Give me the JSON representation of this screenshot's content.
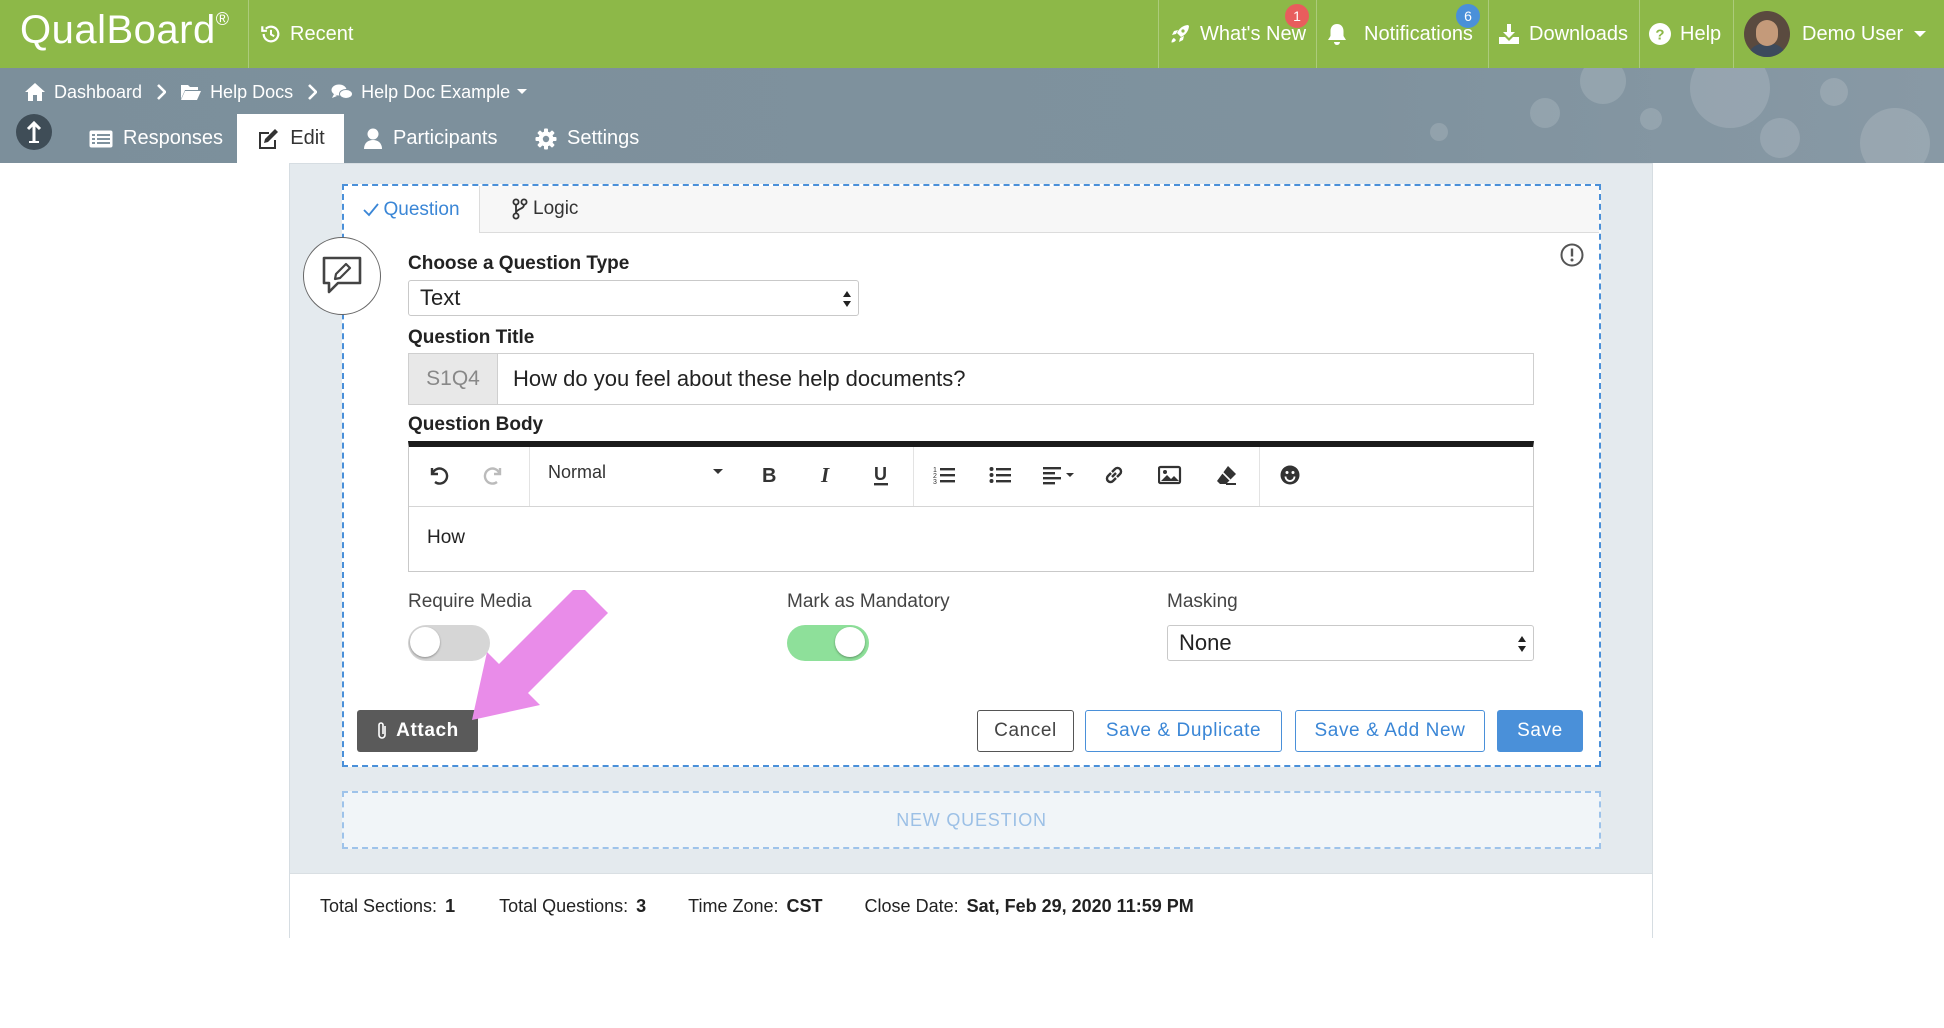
{
  "app": {
    "logo": "QualBoard",
    "logo_mark": "®"
  },
  "topnav": {
    "recent": "Recent",
    "whats_new": "What's New",
    "whats_new_badge": "1",
    "notifications": "Notifications",
    "notifications_badge": "6",
    "downloads": "Downloads",
    "help": "Help",
    "user": "Demo User"
  },
  "breadcrumb": {
    "dashboard": "Dashboard",
    "help_docs": "Help Docs",
    "current": "Help Doc Example"
  },
  "tabs": {
    "responses": "Responses",
    "edit": "Edit",
    "participants": "Participants",
    "settings": "Settings"
  },
  "question_tabs": {
    "question": "Question",
    "logic": "Logic"
  },
  "form": {
    "type_label": "Choose a Question Type",
    "type_value": "Text",
    "title_label": "Question Title",
    "title_prefix": "S1Q4",
    "title_value": "How do you feel about these help documents?",
    "body_label": "Question Body",
    "format_value": "Normal",
    "body_text": "How",
    "require_media_label": "Require Media",
    "require_media": false,
    "mandatory_label": "Mark as Mandatory",
    "mandatory": true,
    "masking_label": "Masking",
    "masking_value": "None"
  },
  "buttons": {
    "attach": "Attach",
    "cancel": "Cancel",
    "save_duplicate": "Save & Duplicate",
    "save_add_new": "Save & Add New",
    "save": "Save",
    "new_question": "NEW QUESTION"
  },
  "summary": {
    "sections_label": "Total Sections:",
    "sections_value": "1",
    "questions_label": "Total Questions:",
    "questions_value": "3",
    "timezone_label": "Time Zone:",
    "timezone_value": "CST",
    "close_label": "Close Date:",
    "close_value": "Sat, Feb 29, 2020 11:59 PM"
  },
  "colors": {
    "topbar": "#8db848",
    "accent_blue": "#4a90d9",
    "toggle_on": "#8ee09a",
    "annotation_arrow": "#e98ce9",
    "badge_red": "#e85d5d",
    "badge_blue": "#4a90d9"
  }
}
